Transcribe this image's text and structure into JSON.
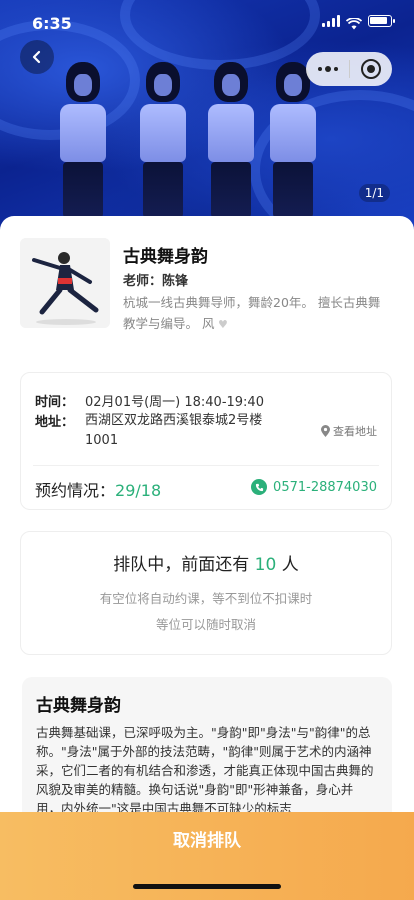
{
  "status_bar": {
    "time": "6:35"
  },
  "hero": {
    "pager": "1/1"
  },
  "teacher": {
    "course_title": "古典舞身韵",
    "name_line": "老师：陈锋",
    "desc": "杭城一线古典舞导师，舞龄20年。 擅长古典舞教学与编导。 风"
  },
  "info": {
    "time_label": "时间：",
    "time_value": "02月01号(周一) 18:40-19:40",
    "addr_label": "地址：",
    "addr_value": "西湖区双龙路西溪银泰城2号楼1001",
    "view_map": "查看地址",
    "booking_label": "预约情况：",
    "booking_value": "29/18",
    "phone": "0571-28874030"
  },
  "queue": {
    "title_prefix": "排队中，前面还有 ",
    "count": "10",
    "title_suffix": " 人",
    "line1": "有空位将自动约课，等不到位不扣课时",
    "line2": "等位可以随时取消"
  },
  "intro": {
    "title": "古典舞身韵",
    "body": "古典舞基础课，已深呼吸为主。\"身韵\"即\"身法\"与\"韵律\"的总称。\"身法\"属于外部的技法范畴，\"韵律\"则属于艺术的内涵神采，它们二者的有机结合和渗透，才能真正体现中国古典舞的风貌及审美的精髓。换句话说\"身韵\"即\"形神兼备，身心并用，内外统一\"这是中国古典舞不可缺少的标志"
  },
  "footer": {
    "cancel_label": "取消排队"
  },
  "colors": {
    "accent_green": "#2bb07a",
    "cancel_orange": "#f5a94d",
    "hero_blue": "#1538b6"
  }
}
